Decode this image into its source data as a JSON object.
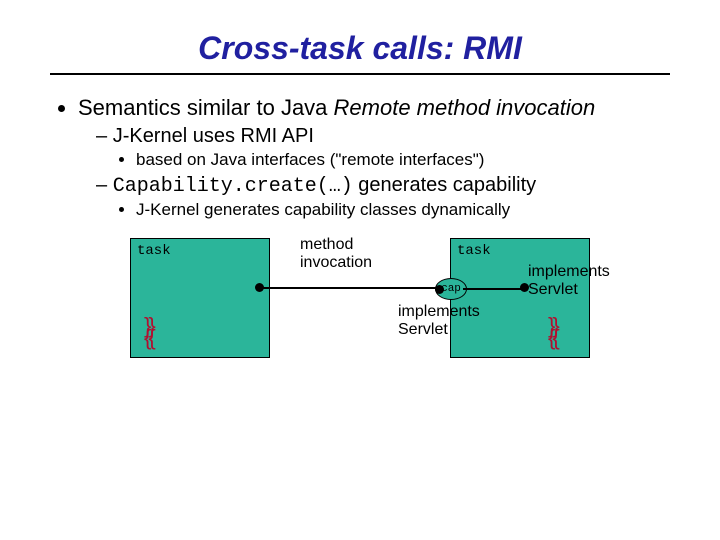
{
  "title": "Cross-task calls: RMI",
  "bullets": {
    "b1_a": "Semantics similar to Java ",
    "b1_b": "Remote method invocation",
    "b2": "J-Kernel uses RMI API",
    "b2_1": "based on Java interfaces (\"remote interfaces\")",
    "b3_a": "Capability.create(…)",
    "b3_b": " generates capability",
    "b3_1": "J-Kernel generates capability classes dynamically"
  },
  "diagram": {
    "task_label": "task",
    "cap_label": "cap",
    "method_invocation": "method\ninvocation",
    "implements_servlet": "implements\nServlet"
  }
}
